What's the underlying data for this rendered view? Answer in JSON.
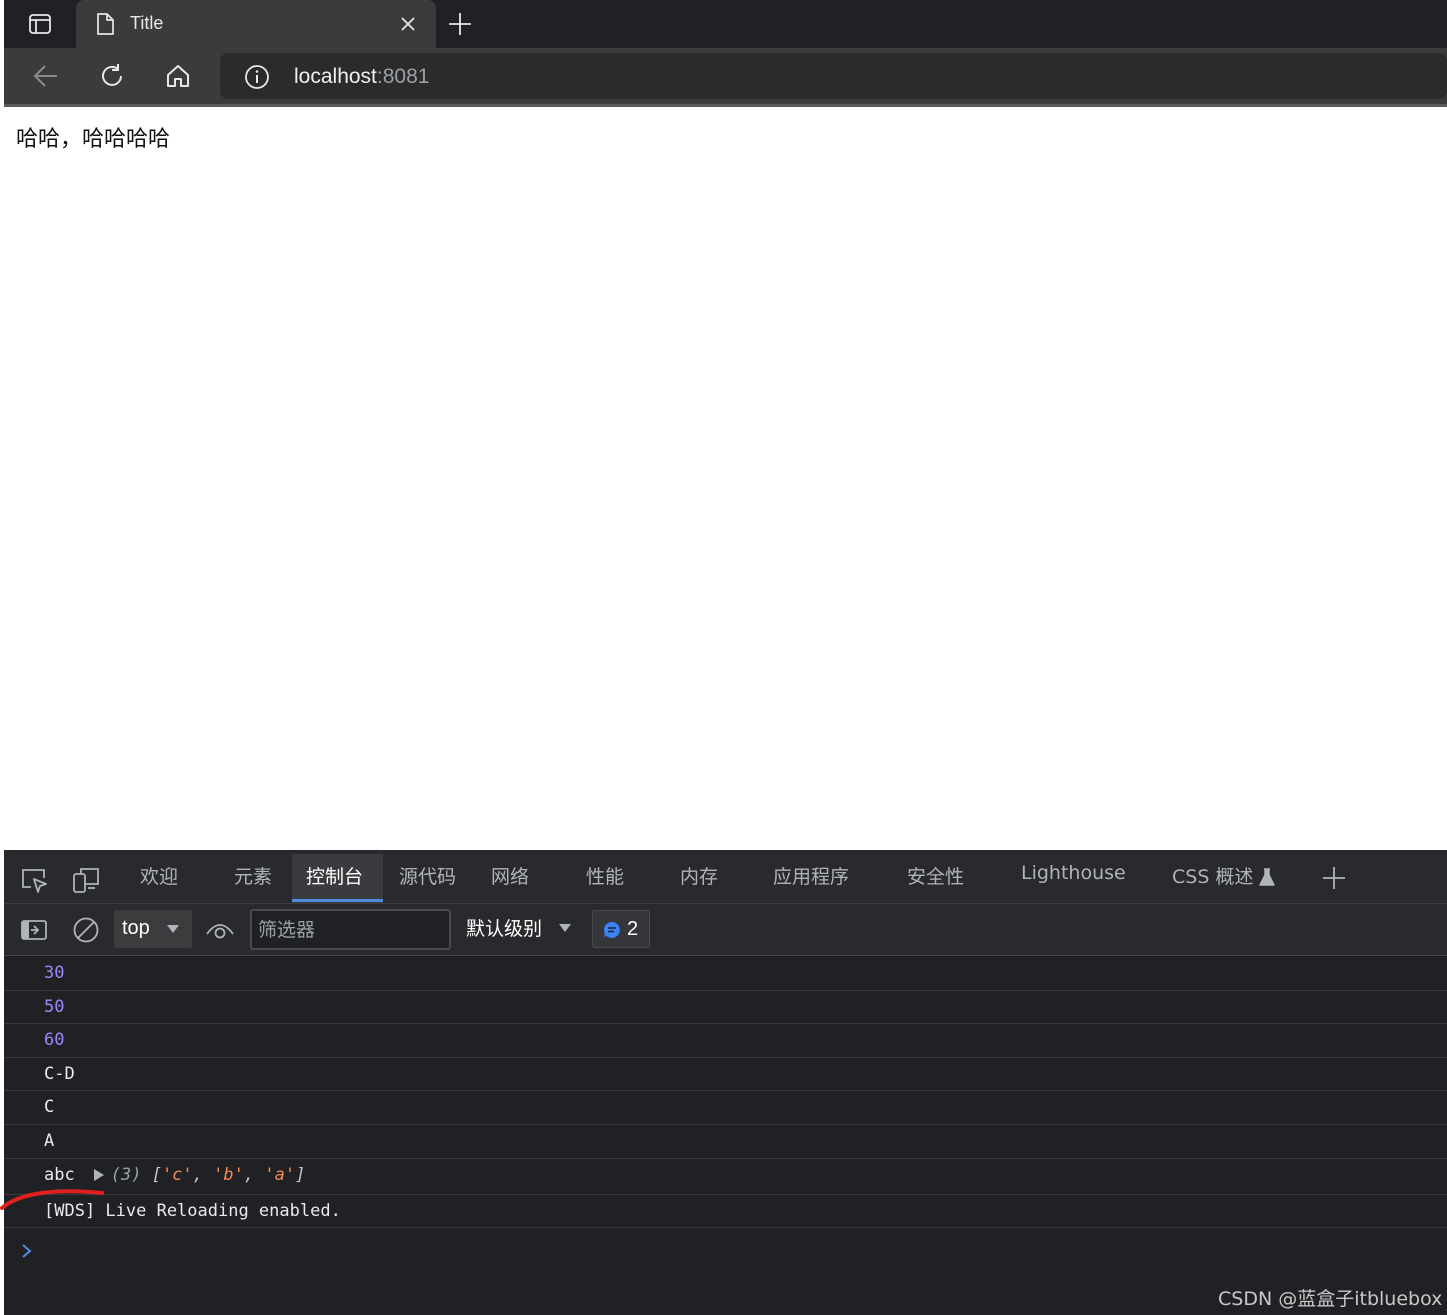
{
  "browser": {
    "tab": {
      "title": "Title"
    },
    "address": {
      "host": "localhost",
      "port": ":8081"
    }
  },
  "page": {
    "text": "哈哈，哈哈哈哈"
  },
  "devtools": {
    "tabs": [
      {
        "label": "欢迎"
      },
      {
        "label": "元素"
      },
      {
        "label": "控制台",
        "active": true
      },
      {
        "label": "源代码"
      },
      {
        "label": "网络"
      },
      {
        "label": "性能"
      },
      {
        "label": "内存"
      },
      {
        "label": "应用程序"
      },
      {
        "label": "安全性"
      },
      {
        "label": "Lighthouse"
      },
      {
        "label": "CSS 概述"
      }
    ],
    "toolbar": {
      "context": "top",
      "filter_placeholder": "筛选器",
      "level": "默认级别",
      "issues_count": "2"
    },
    "console": {
      "messages": [
        "30",
        "50",
        "60",
        "C-D",
        "C",
        "A",
        "abc",
        "[WDS] Live Reloading enabled."
      ],
      "array_preview": {
        "length": "(3)",
        "items": [
          "'c'",
          "'b'",
          "'a'"
        ]
      }
    }
  },
  "watermark": "CSDN @蓝盒子itbluebox",
  "colors": {
    "accent": "#4d8ddb",
    "number": "#9e86ff",
    "string": "#f28b54",
    "annotation": "#e0201e"
  }
}
